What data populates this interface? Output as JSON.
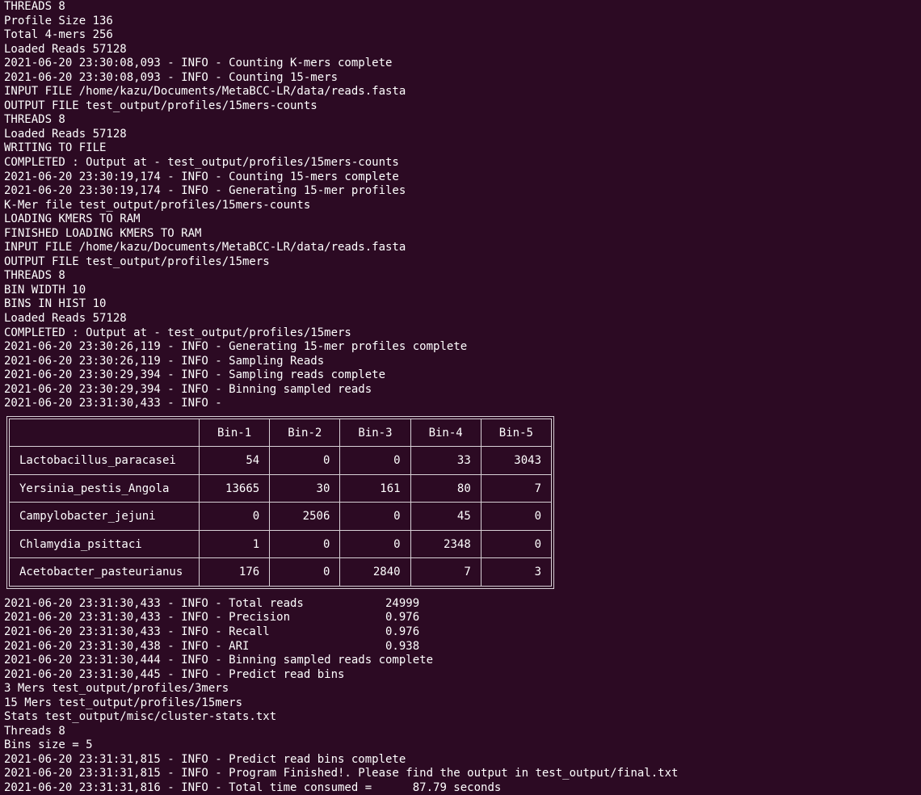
{
  "log_top": [
    "THREADS 8",
    "Profile Size 136",
    "Total 4-mers 256",
    "Loaded Reads 57128",
    "2021-06-20 23:30:08,093 - INFO - Counting K-mers complete",
    "2021-06-20 23:30:08,093 - INFO - Counting 15-mers",
    "INPUT FILE /home/kazu/Documents/MetaBCC-LR/data/reads.fasta",
    "OUTPUT FILE test_output/profiles/15mers-counts",
    "THREADS 8",
    "Loaded Reads 57128",
    "WRITING TO FILE",
    "COMPLETED : Output at - test_output/profiles/15mers-counts",
    "2021-06-20 23:30:19,174 - INFO - Counting 15-mers complete",
    "2021-06-20 23:30:19,174 - INFO - Generating 15-mer profiles",
    "K-Mer file test_output/profiles/15mers-counts",
    "LOADING KMERS TO RAM",
    "FINISHED LOADING KMERS TO RAM",
    "INPUT FILE /home/kazu/Documents/MetaBCC-LR/data/reads.fasta",
    "OUTPUT FILE test_output/profiles/15mers",
    "THREADS 8",
    "BIN WIDTH 10",
    "BINS IN HIST 10",
    "Loaded Reads 57128",
    "COMPLETED : Output at - test_output/profiles/15mers",
    "2021-06-20 23:30:26,119 - INFO - Generating 15-mer profiles complete",
    "2021-06-20 23:30:26,119 - INFO - Sampling Reads",
    "2021-06-20 23:30:29,394 - INFO - Sampling reads complete",
    "2021-06-20 23:30:29,394 - INFO - Binning sampled reads",
    "2021-06-20 23:31:30,433 - INFO -"
  ],
  "bin_table": {
    "headers": [
      "",
      "Bin-1",
      "Bin-2",
      "Bin-3",
      "Bin-4",
      "Bin-5"
    ],
    "rows": [
      {
        "name": "Lactobacillus_paracasei",
        "values": [
          "54",
          "0",
          "0",
          "33",
          "3043"
        ]
      },
      {
        "name": "Yersinia_pestis_Angola",
        "values": [
          "13665",
          "30",
          "161",
          "80",
          "7"
        ]
      },
      {
        "name": "Campylobacter_jejuni",
        "values": [
          "0",
          "2506",
          "0",
          "45",
          "0"
        ]
      },
      {
        "name": "Chlamydia_psittaci",
        "values": [
          "1",
          "0",
          "0",
          "2348",
          "0"
        ]
      },
      {
        "name": "Acetobacter_pasteurianus",
        "values": [
          "176",
          "0",
          "2840",
          "7",
          "3"
        ]
      }
    ]
  },
  "log_bottom": [
    "2021-06-20 23:31:30,433 - INFO - Total reads            24999",
    "2021-06-20 23:31:30,433 - INFO - Precision              0.976",
    "2021-06-20 23:31:30,433 - INFO - Recall                 0.976",
    "2021-06-20 23:31:30,438 - INFO - ARI                    0.938",
    "2021-06-20 23:31:30,444 - INFO - Binning sampled reads complete",
    "2021-06-20 23:31:30,445 - INFO - Predict read bins",
    "3 Mers test_output/profiles/3mers",
    "15 Mers test_output/profiles/15mers",
    "Stats test_output/misc/cluster-stats.txt",
    "Threads 8",
    "Bins size = 5",
    "2021-06-20 23:31:31,815 - INFO - Predict read bins complete",
    "2021-06-20 23:31:31,815 - INFO - Program Finished!. Please find the output in test_output/final.txt",
    "2021-06-20 23:31:31,816 - INFO - Total time consumed =      87.79 seconds"
  ],
  "colors": {
    "background": "#2c0a23",
    "text": "#ffffff",
    "table_border": "#d8d0d6"
  }
}
